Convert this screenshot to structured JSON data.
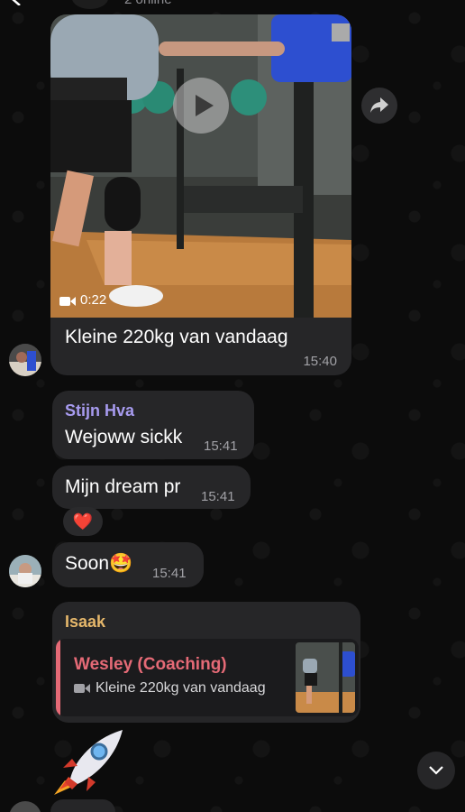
{
  "header": {
    "status": "2 online",
    "back_icon": "chevron-left-icon"
  },
  "video_message": {
    "duration": "0:22",
    "caption": "Kleine 220kg van vandaag",
    "time": "15:40",
    "play_icon": "play-icon",
    "share_icon": "share-forward-icon"
  },
  "messages": [
    {
      "sender": "Stijn Hva",
      "text": "Wejoww sickk",
      "time": "15:41"
    },
    {
      "text": "Mijn dream pr",
      "time": "15:41",
      "reaction": "❤️"
    },
    {
      "text": "Soon🤩",
      "time": "15:41"
    }
  ],
  "reply_message": {
    "sender": "Isaak",
    "quoted_sender": "Wesley (Coaching)",
    "quoted_text": "Kleine 220kg van vandaag"
  },
  "sticker": "rocket-sticker",
  "colors": {
    "background": "#0b0b0b",
    "bubble": "#262628",
    "sender_purple": "#a79bef",
    "sender_gold": "#e5b76b",
    "quote_accent": "#e56a76",
    "timestamp": "#a1a1a6"
  }
}
